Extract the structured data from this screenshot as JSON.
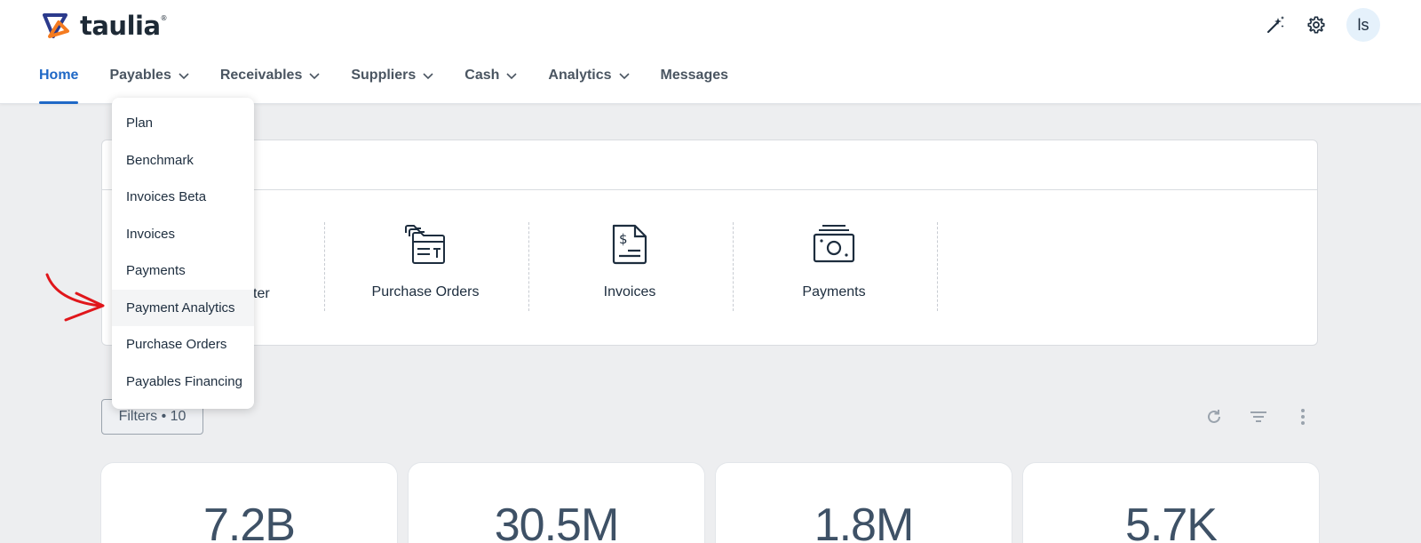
{
  "app": {
    "logo_text": "taulia",
    "logo_mark": "®",
    "user_initials": "ls"
  },
  "header": {
    "icons": [
      "magic-wand-icon",
      "gear-icon"
    ]
  },
  "nav": {
    "items": [
      {
        "label": "Home",
        "active": true
      },
      {
        "label": "Payables",
        "dropdown": true
      },
      {
        "label": "Receivables",
        "dropdown": true
      },
      {
        "label": "Suppliers",
        "dropdown": true
      },
      {
        "label": "Cash",
        "dropdown": true
      },
      {
        "label": "Analytics",
        "dropdown": true
      },
      {
        "label": "Messages"
      }
    ]
  },
  "dropdown": {
    "items": [
      {
        "label": "Plan"
      },
      {
        "label": "Benchmark"
      },
      {
        "label": "Invoices Beta"
      },
      {
        "label": "Invoices"
      },
      {
        "label": "Payments"
      },
      {
        "label": "Payment Analytics",
        "hovered": true
      },
      {
        "label": "Purchase Orders"
      },
      {
        "label": "Payables Financing"
      }
    ]
  },
  "tiles": {
    "partial_label": "ter",
    "items": [
      {
        "label": "Purchase Orders",
        "icon": "purchase-orders-icon"
      },
      {
        "label": "Invoices",
        "icon": "invoice-icon"
      },
      {
        "label": "Payments",
        "icon": "payments-icon"
      }
    ]
  },
  "filters": {
    "label": "Filters • 10"
  },
  "toolbar": {
    "icons": [
      "refresh-icon",
      "filter-icon",
      "more-vertical-icon"
    ]
  },
  "kpis": [
    {
      "value": "7.2B"
    },
    {
      "value": "30.5M"
    },
    {
      "value": "1.8M"
    },
    {
      "value": "5.7K"
    }
  ],
  "colors": {
    "accent": "#1f68c6",
    "annotation_arrow": "#e0161b"
  }
}
